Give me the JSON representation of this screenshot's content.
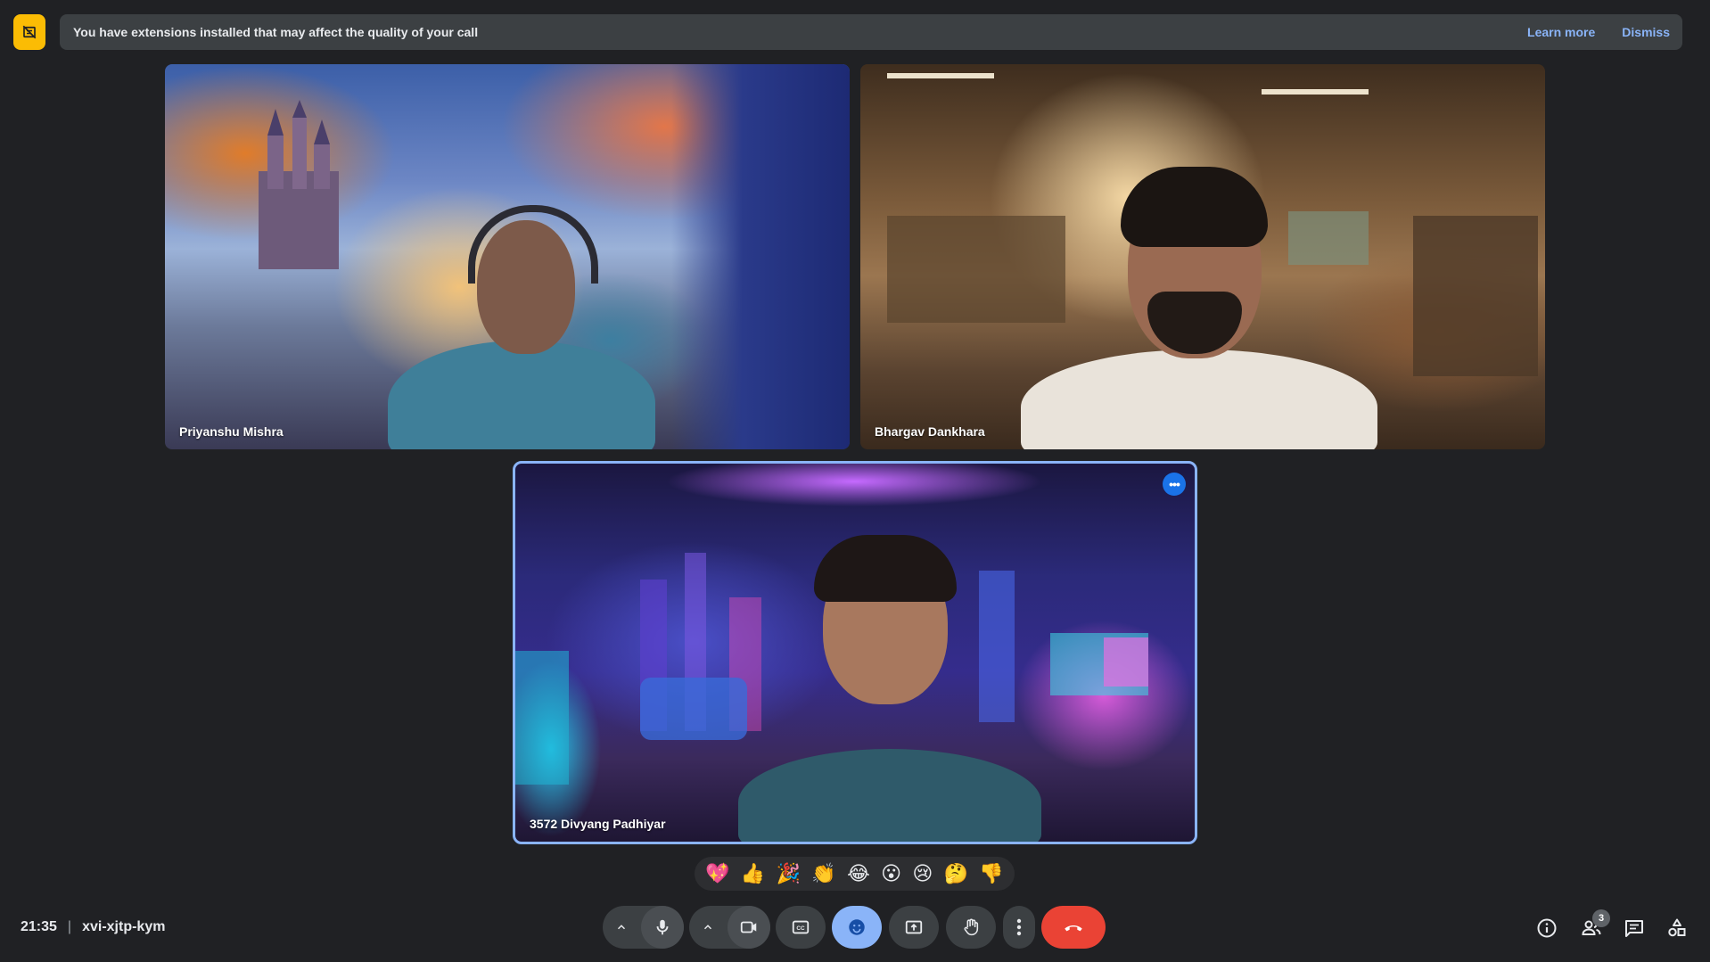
{
  "banner": {
    "message": "You have extensions installed that may affect the quality of your call",
    "learn_more": "Learn more",
    "dismiss": "Dismiss"
  },
  "participants": [
    {
      "name": "Priyanshu Mishra"
    },
    {
      "name": "Bhargav Dankhara"
    },
    {
      "name": "3572 Divyang Padhiyar"
    }
  ],
  "reactions": [
    "💖",
    "👍",
    "🎉",
    "👏",
    "😂",
    "😮",
    "😢",
    "🤔",
    "👎"
  ],
  "meeting": {
    "time": "21:35",
    "code": "xvi-xjtp-kym"
  },
  "people_count": "3",
  "colors": {
    "accent": "#8ab4f8",
    "leave": "#ea4335",
    "warning": "#fbbc04",
    "control_bg": "#3c4043"
  }
}
